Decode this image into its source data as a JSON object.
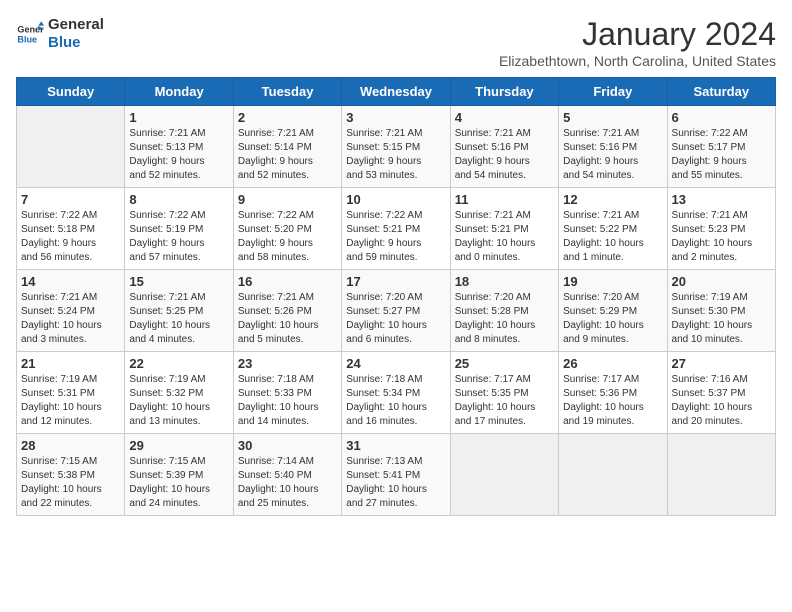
{
  "logo": {
    "line1": "General",
    "line2": "Blue"
  },
  "title": "January 2024",
  "subtitle": "Elizabethtown, North Carolina, United States",
  "weekdays": [
    "Sunday",
    "Monday",
    "Tuesday",
    "Wednesday",
    "Thursday",
    "Friday",
    "Saturday"
  ],
  "weeks": [
    [
      {
        "day": "",
        "content": ""
      },
      {
        "day": "1",
        "content": "Sunrise: 7:21 AM\nSunset: 5:13 PM\nDaylight: 9 hours\nand 52 minutes."
      },
      {
        "day": "2",
        "content": "Sunrise: 7:21 AM\nSunset: 5:14 PM\nDaylight: 9 hours\nand 52 minutes."
      },
      {
        "day": "3",
        "content": "Sunrise: 7:21 AM\nSunset: 5:15 PM\nDaylight: 9 hours\nand 53 minutes."
      },
      {
        "day": "4",
        "content": "Sunrise: 7:21 AM\nSunset: 5:16 PM\nDaylight: 9 hours\nand 54 minutes."
      },
      {
        "day": "5",
        "content": "Sunrise: 7:21 AM\nSunset: 5:16 PM\nDaylight: 9 hours\nand 54 minutes."
      },
      {
        "day": "6",
        "content": "Sunrise: 7:22 AM\nSunset: 5:17 PM\nDaylight: 9 hours\nand 55 minutes."
      }
    ],
    [
      {
        "day": "7",
        "content": "Sunrise: 7:22 AM\nSunset: 5:18 PM\nDaylight: 9 hours\nand 56 minutes."
      },
      {
        "day": "8",
        "content": "Sunrise: 7:22 AM\nSunset: 5:19 PM\nDaylight: 9 hours\nand 57 minutes."
      },
      {
        "day": "9",
        "content": "Sunrise: 7:22 AM\nSunset: 5:20 PM\nDaylight: 9 hours\nand 58 minutes."
      },
      {
        "day": "10",
        "content": "Sunrise: 7:22 AM\nSunset: 5:21 PM\nDaylight: 9 hours\nand 59 minutes."
      },
      {
        "day": "11",
        "content": "Sunrise: 7:21 AM\nSunset: 5:21 PM\nDaylight: 10 hours\nand 0 minutes."
      },
      {
        "day": "12",
        "content": "Sunrise: 7:21 AM\nSunset: 5:22 PM\nDaylight: 10 hours\nand 1 minute."
      },
      {
        "day": "13",
        "content": "Sunrise: 7:21 AM\nSunset: 5:23 PM\nDaylight: 10 hours\nand 2 minutes."
      }
    ],
    [
      {
        "day": "14",
        "content": "Sunrise: 7:21 AM\nSunset: 5:24 PM\nDaylight: 10 hours\nand 3 minutes."
      },
      {
        "day": "15",
        "content": "Sunrise: 7:21 AM\nSunset: 5:25 PM\nDaylight: 10 hours\nand 4 minutes."
      },
      {
        "day": "16",
        "content": "Sunrise: 7:21 AM\nSunset: 5:26 PM\nDaylight: 10 hours\nand 5 minutes."
      },
      {
        "day": "17",
        "content": "Sunrise: 7:20 AM\nSunset: 5:27 PM\nDaylight: 10 hours\nand 6 minutes."
      },
      {
        "day": "18",
        "content": "Sunrise: 7:20 AM\nSunset: 5:28 PM\nDaylight: 10 hours\nand 8 minutes."
      },
      {
        "day": "19",
        "content": "Sunrise: 7:20 AM\nSunset: 5:29 PM\nDaylight: 10 hours\nand 9 minutes."
      },
      {
        "day": "20",
        "content": "Sunrise: 7:19 AM\nSunset: 5:30 PM\nDaylight: 10 hours\nand 10 minutes."
      }
    ],
    [
      {
        "day": "21",
        "content": "Sunrise: 7:19 AM\nSunset: 5:31 PM\nDaylight: 10 hours\nand 12 minutes."
      },
      {
        "day": "22",
        "content": "Sunrise: 7:19 AM\nSunset: 5:32 PM\nDaylight: 10 hours\nand 13 minutes."
      },
      {
        "day": "23",
        "content": "Sunrise: 7:18 AM\nSunset: 5:33 PM\nDaylight: 10 hours\nand 14 minutes."
      },
      {
        "day": "24",
        "content": "Sunrise: 7:18 AM\nSunset: 5:34 PM\nDaylight: 10 hours\nand 16 minutes."
      },
      {
        "day": "25",
        "content": "Sunrise: 7:17 AM\nSunset: 5:35 PM\nDaylight: 10 hours\nand 17 minutes."
      },
      {
        "day": "26",
        "content": "Sunrise: 7:17 AM\nSunset: 5:36 PM\nDaylight: 10 hours\nand 19 minutes."
      },
      {
        "day": "27",
        "content": "Sunrise: 7:16 AM\nSunset: 5:37 PM\nDaylight: 10 hours\nand 20 minutes."
      }
    ],
    [
      {
        "day": "28",
        "content": "Sunrise: 7:15 AM\nSunset: 5:38 PM\nDaylight: 10 hours\nand 22 minutes."
      },
      {
        "day": "29",
        "content": "Sunrise: 7:15 AM\nSunset: 5:39 PM\nDaylight: 10 hours\nand 24 minutes."
      },
      {
        "day": "30",
        "content": "Sunrise: 7:14 AM\nSunset: 5:40 PM\nDaylight: 10 hours\nand 25 minutes."
      },
      {
        "day": "31",
        "content": "Sunrise: 7:13 AM\nSunset: 5:41 PM\nDaylight: 10 hours\nand 27 minutes."
      },
      {
        "day": "",
        "content": ""
      },
      {
        "day": "",
        "content": ""
      },
      {
        "day": "",
        "content": ""
      }
    ]
  ]
}
